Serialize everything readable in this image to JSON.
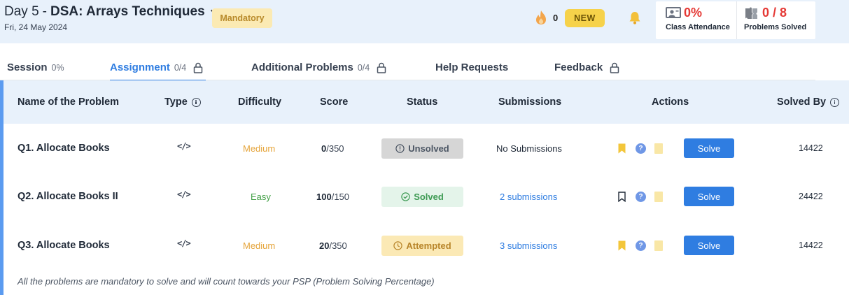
{
  "header": {
    "day": "Day 5",
    "separator": "-",
    "title": "DSA: Arrays Techniques",
    "date": "Fri, 24 May 2024",
    "badge": "Mandatory",
    "streak_count": "0",
    "new_label": "NEW",
    "icons": {
      "dropdown": "chevron-down-icon",
      "streak": "flame-icon",
      "notifications": "bell-icon"
    }
  },
  "stats": {
    "attendance_value": "0%",
    "attendance_label": "Class Attendance",
    "problems_value": "0 / 8",
    "problems_label": "Problems Solved"
  },
  "tabs": [
    {
      "label": "Session",
      "count": "0%",
      "locked": false,
      "active": false
    },
    {
      "label": "Assignment",
      "count": "0/4",
      "locked": true,
      "active": true
    },
    {
      "label": "Additional Problems",
      "count": "0/4",
      "locked": true,
      "active": false
    },
    {
      "label": "Help Requests",
      "count": "",
      "locked": false,
      "active": false
    },
    {
      "label": "Feedback",
      "count": "",
      "locked": true,
      "active": false
    }
  ],
  "table": {
    "headers": {
      "name": "Name of the Problem",
      "type": "Type",
      "difficulty": "Difficulty",
      "score": "Score",
      "status": "Status",
      "submissions": "Submissions",
      "actions": "Actions",
      "solved_by": "Solved By"
    },
    "rows": [
      {
        "name": "Q1. Allocate Books",
        "type_icon": "code-icon",
        "difficulty": "Medium",
        "score": "0",
        "max_score": "/350",
        "status": "Unsolved",
        "submissions": "No Submissions",
        "bookmarked": true,
        "solve_label": "Solve",
        "solved_by": "14422"
      },
      {
        "name": "Q2. Allocate Books II",
        "type_icon": "code-icon",
        "difficulty": "Easy",
        "score": "100",
        "max_score": "/150",
        "status": "Solved",
        "submissions": "2 submissions",
        "bookmarked": false,
        "solve_label": "Solve",
        "solved_by": "24422"
      },
      {
        "name": "Q3. Allocate Books",
        "type_icon": "code-icon",
        "difficulty": "Medium",
        "score": "20",
        "max_score": "/350",
        "status": "Attempted",
        "submissions": "3 submissions",
        "bookmarked": true,
        "solve_label": "Solve",
        "solved_by": "14422"
      }
    ],
    "footnote": "All the problems are mandatory to solve and will count towards your PSP (Problem Solving Percentage)"
  },
  "colors": {
    "accent": "#2f7de1",
    "header_bg": "#e8f1fb",
    "medium": "#e5a43a",
    "easy": "#43a047",
    "danger": "#e53935"
  }
}
